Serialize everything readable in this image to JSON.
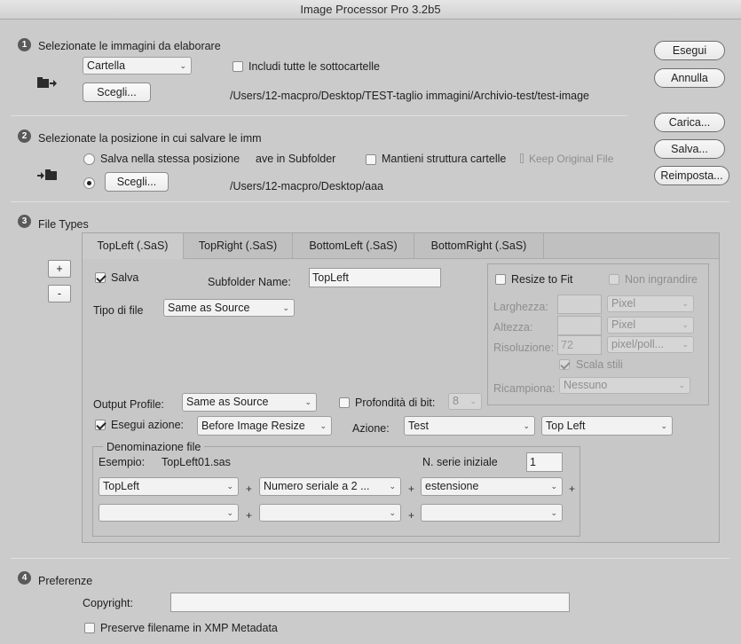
{
  "window": {
    "title": "Image Processor Pro 3.2b5"
  },
  "section1": {
    "number": "1",
    "title": "Selezionate le immagini da elaborare",
    "source_select": "Cartella",
    "include_subfolders_label": "Includi tutte le sottocartelle",
    "include_subfolders_checked": false,
    "choose_label": "Scegli...",
    "path": "/Users/12-macpro/Desktop/TEST-taglio immagini/Archivio-test/test-image"
  },
  "section2": {
    "number": "2",
    "title": "Selezionate la posizione in cui salvare le imm",
    "same_location_label": "Salva nella stessa posizione",
    "save_in_subfolder_label": "ave in Subfolder",
    "keep_structure_label": "Mantieni struttura cartelle",
    "keep_original_file_label": "Keep Original File",
    "choose_label": "Scegli...",
    "path": "/Users/12-macpro/Desktop/aaa"
  },
  "section3": {
    "number": "3",
    "title": "File Types",
    "add_label": "+",
    "remove_label": "-",
    "tabs": [
      {
        "label": "TopLeft (.SaS)"
      },
      {
        "label": "TopRight (.SaS)"
      },
      {
        "label": "BottomLeft (.SaS)"
      },
      {
        "label": "BottomRight (.SaS)"
      }
    ],
    "save_label": "Salva",
    "save_checked": true,
    "subfolder_name_label": "Subfolder Name:",
    "subfolder_name_value": "TopLeft",
    "file_type_label": "Tipo di file",
    "file_type_value": "Same as Source",
    "resize": {
      "resize_to_fit_label": "Resize to Fit",
      "no_enlarge_label": "Non ingrandire",
      "width_label": "Larghezza:",
      "width_unit": "Pixel",
      "height_label": "Altezza:",
      "height_unit": "Pixel",
      "resolution_label": "Risoluzione:",
      "resolution_value": "72",
      "resolution_unit": "pixel/poll...",
      "scale_styles_label": "Scala stili",
      "resample_label": "Ricampiona:",
      "resample_value": "Nessuno"
    },
    "output_profile_label": "Output Profile:",
    "output_profile_value": "Same as Source",
    "bit_depth_label": "Profondità di bit:",
    "bit_depth_value": "8",
    "run_action_label": "Esegui azione:",
    "run_action_checked": true,
    "run_action_timing": "Before Image Resize",
    "action_label": "Azione:",
    "action_set": "Test",
    "action_name": "Top Left",
    "naming": {
      "title": "Denominazione file",
      "example_label": "Esempio:",
      "example_value": "TopLeft01.sas",
      "serial_start_label": "N. serie iniziale",
      "serial_start_value": "1",
      "row1": [
        "TopLeft",
        "Numero seriale a 2 ...",
        "estensione"
      ],
      "row2": [
        "",
        "",
        ""
      ],
      "plus": "+"
    }
  },
  "buttons": {
    "run": "Esegui",
    "cancel": "Annulla",
    "load": "Carica...",
    "save": "Salva...",
    "reset": "Reimposta..."
  },
  "section4": {
    "number": "4",
    "title": "Preferenze",
    "copyright_label": "Copyright:",
    "copyright_value": "",
    "preserve_filename_label": "Preserve filename in XMP Metadata"
  }
}
